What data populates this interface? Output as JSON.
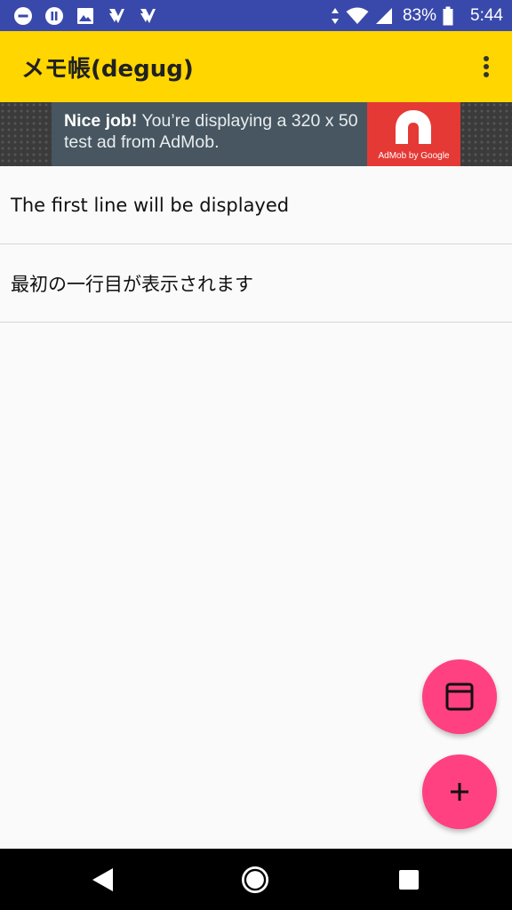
{
  "status_bar": {
    "battery": "83%",
    "time": "5:44",
    "notification_icons": [
      "dnd-icon",
      "pause-icon",
      "image-icon",
      "app-notification-icon",
      "app-notification-icon"
    ],
    "system_icons": [
      "data-arrows-icon",
      "wifi-icon",
      "signal-icon",
      "battery-icon"
    ]
  },
  "app_bar": {
    "title": "メモ帳(degug)",
    "overflow_icon": "more-vert-icon"
  },
  "ad": {
    "bold_text": "Nice job!",
    "body_text": " You’re displaying a 320 x 50 test ad from AdMob.",
    "logo_caption": "AdMob by Google"
  },
  "memos": [
    {
      "text": "The first line will be displayed"
    },
    {
      "text": "最初の一行目が表示されます"
    }
  ],
  "fabs": {
    "secondary_icon": "window-icon",
    "primary_icon": "add-icon"
  },
  "nav_bar": {
    "icons": [
      "back-icon",
      "home-icon",
      "recents-icon"
    ]
  },
  "colors": {
    "status_bar": "#3949ab",
    "app_bar": "#ffd600",
    "fab": "#ff4081",
    "ad_background": "#475660",
    "ad_logo": "#e53935"
  }
}
